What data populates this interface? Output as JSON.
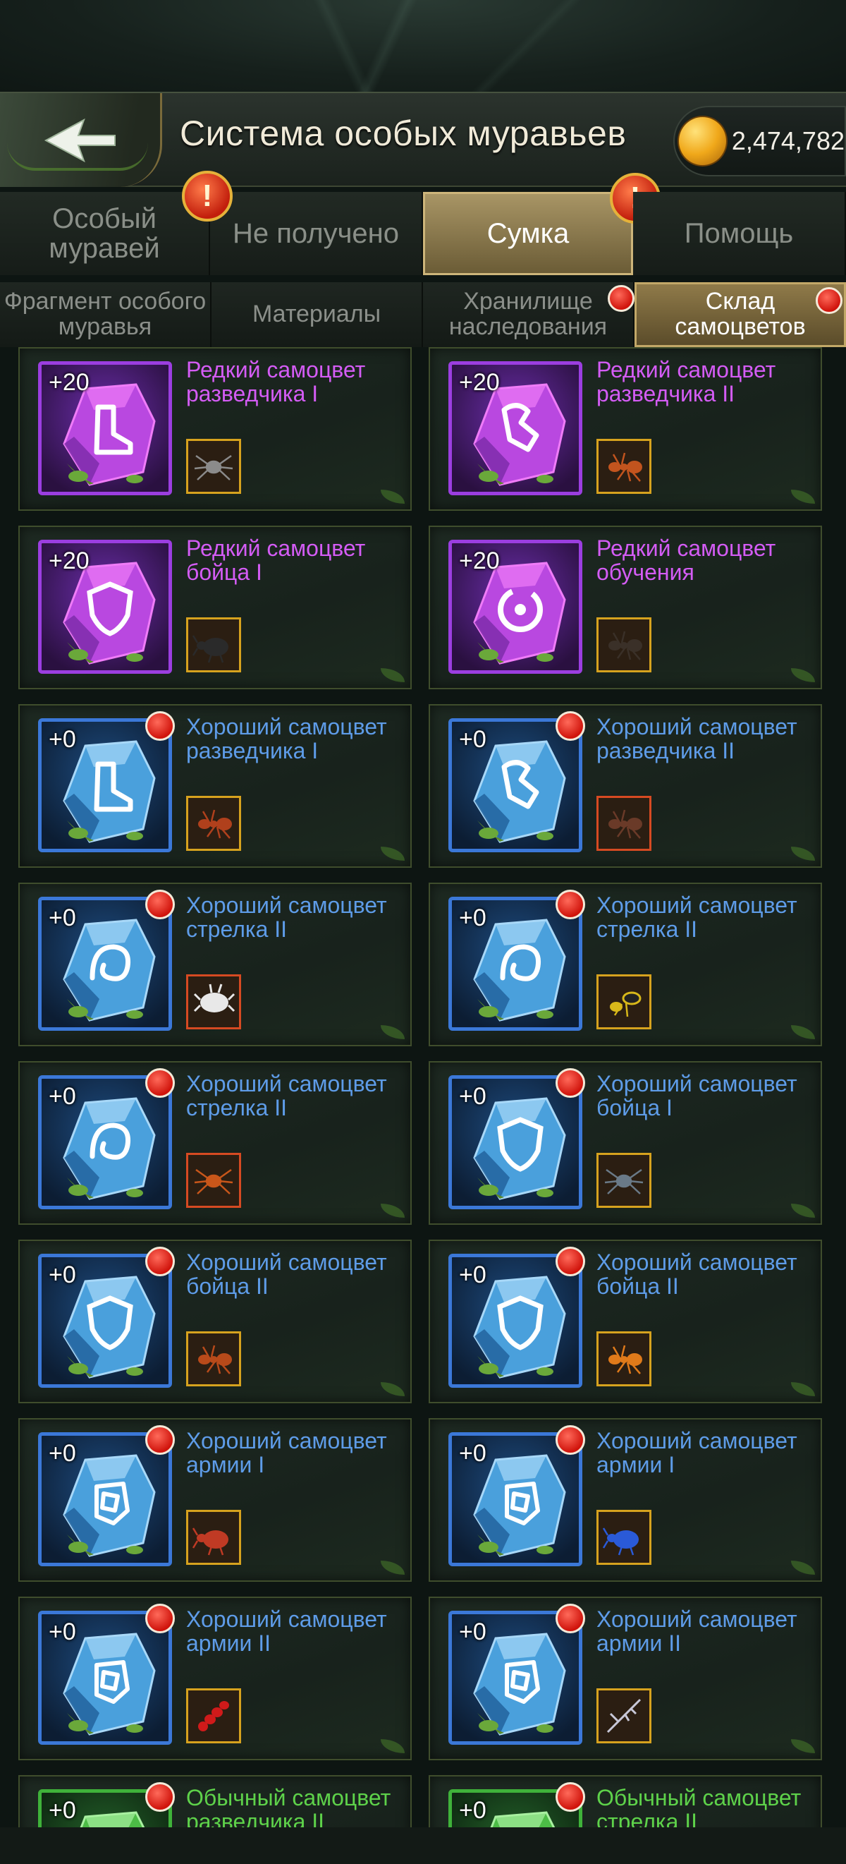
{
  "header": {
    "title": "Система особых муравьев",
    "currency_amount": "2,474,782",
    "back_icon": "back-arrow-icon",
    "currency_icon": "amber-icon"
  },
  "main_tabs": [
    {
      "label": "Особый муравей",
      "active": false,
      "warning": false
    },
    {
      "label": "Не получено",
      "active": false,
      "warning": true
    },
    {
      "label": "Сумка",
      "active": true,
      "warning": true
    },
    {
      "label": "Помощь",
      "active": false,
      "warning": false
    }
  ],
  "warning_symbol": "!",
  "sub_tabs": [
    {
      "label": "Фрагмент особого муравья",
      "active": false,
      "dot": false
    },
    {
      "label": "Материалы",
      "active": false,
      "dot": false
    },
    {
      "label": "Хранилище наследования",
      "active": false,
      "dot": true
    },
    {
      "label": "Склад самоцветов",
      "active": true,
      "dot": true
    }
  ],
  "gems": [
    {
      "name": "Редкий самоцвет разведчика I",
      "level": "+20",
      "rarity": "rare",
      "dot": false,
      "glyph": "boot",
      "ant": "spider",
      "ant_color": "#8b8b8b",
      "ant_frame": "gold"
    },
    {
      "name": "Редкий самоцвет разведчика II",
      "level": "+20",
      "rarity": "rare",
      "dot": false,
      "glyph": "boot2",
      "ant": "ant",
      "ant_color": "#c2541e",
      "ant_frame": "gold"
    },
    {
      "name": "Редкий самоцвет бойца I",
      "level": "+20",
      "rarity": "rare",
      "dot": false,
      "glyph": "shield",
      "ant": "beetle",
      "ant_color": "#2a2a2a",
      "ant_frame": "gold"
    },
    {
      "name": "Редкий самоцвет обучения",
      "level": "+20",
      "rarity": "rare",
      "dot": false,
      "glyph": "ring",
      "ant": "ant",
      "ant_color": "#3a3028",
      "ant_frame": "gold"
    },
    {
      "name": "Хороший самоцвет разведчика I",
      "level": "+0",
      "rarity": "good",
      "dot": true,
      "glyph": "boot",
      "ant": "ant",
      "ant_color": "#b0401c",
      "ant_frame": "gold"
    },
    {
      "name": "Хороший самоцвет разведчика II",
      "level": "+0",
      "rarity": "good",
      "dot": true,
      "glyph": "boot2",
      "ant": "ant",
      "ant_color": "#6a3a28",
      "ant_frame": "red"
    },
    {
      "name": "Хороший самоцвет стрелка II",
      "level": "+0",
      "rarity": "good",
      "dot": true,
      "glyph": "swirl",
      "ant": "fluffy",
      "ant_color": "#e8e8e8",
      "ant_frame": "red"
    },
    {
      "name": "Хороший самоцвет стрелка II",
      "level": "+0",
      "rarity": "good",
      "dot": true,
      "glyph": "swirl",
      "ant": "wasp",
      "ant_color": "#d8b81a",
      "ant_frame": "gold"
    },
    {
      "name": "Хороший самоцвет стрелка II",
      "level": "+0",
      "rarity": "good",
      "dot": true,
      "glyph": "swirl",
      "ant": "spider",
      "ant_color": "#c8561a",
      "ant_frame": "red"
    },
    {
      "name": "Хороший самоцвет бойца I",
      "level": "+0",
      "rarity": "good",
      "dot": true,
      "glyph": "shield",
      "ant": "spider",
      "ant_color": "#6a7a88",
      "ant_frame": "gold"
    },
    {
      "name": "Хороший самоцвет бойца II",
      "level": "+0",
      "rarity": "good",
      "dot": true,
      "glyph": "shield",
      "ant": "ant",
      "ant_color": "#b84a1a",
      "ant_frame": "gold"
    },
    {
      "name": "Хороший самоцвет бойца II",
      "level": "+0",
      "rarity": "good",
      "dot": true,
      "glyph": "shield",
      "ant": "ant",
      "ant_color": "#e07a1a",
      "ant_frame": "gold"
    },
    {
      "name": "Хороший самоцвет армии I",
      "level": "+0",
      "rarity": "good",
      "dot": true,
      "glyph": "army",
      "ant": "beetle",
      "ant_color": "#c03a24",
      "ant_frame": "gold"
    },
    {
      "name": "Хороший самоцвет армии I",
      "level": "+0",
      "rarity": "good",
      "dot": true,
      "glyph": "army",
      "ant": "beetle",
      "ant_color": "#2a5ad8",
      "ant_frame": "gold"
    },
    {
      "name": "Хороший самоцвет армии II",
      "level": "+0",
      "rarity": "good",
      "dot": true,
      "glyph": "army",
      "ant": "worm",
      "ant_color": "#d01a1a",
      "ant_frame": "gold"
    },
    {
      "name": "Хороший самоцвет армии II",
      "level": "+0",
      "rarity": "good",
      "dot": true,
      "glyph": "army",
      "ant": "mantis",
      "ant_color": "#c8c8d8",
      "ant_frame": "gold"
    },
    {
      "name": "Обычный самоцвет разведчика II",
      "level": "+0",
      "rarity": "common",
      "dot": true,
      "glyph": "boot2",
      "ant": "ant",
      "ant_color": "#6a3a28",
      "ant_frame": "gold"
    },
    {
      "name": "Обычный самоцвет стрелка II",
      "level": "+0",
      "rarity": "common",
      "dot": true,
      "glyph": "swirl",
      "ant": "ant",
      "ant_color": "#6a3a28",
      "ant_frame": "gold"
    }
  ]
}
